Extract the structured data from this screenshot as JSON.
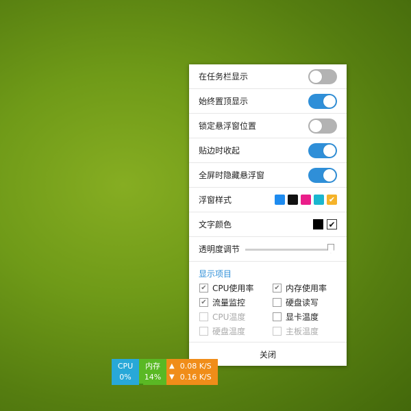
{
  "panel": {
    "toggles": [
      {
        "label": "在任务栏显示",
        "on": false
      },
      {
        "label": "始终置顶显示",
        "on": true
      },
      {
        "label": "锁定悬浮窗位置",
        "on": false
      },
      {
        "label": "贴边时收起",
        "on": true
      },
      {
        "label": "全屏时隐藏悬浮窗",
        "on": true
      }
    ],
    "style_label": "浮窗样式",
    "style_colors": [
      "#1e8bef",
      "#111111",
      "#ea1e8a",
      "#1bb6cf",
      "#f5b32a"
    ],
    "style_selected_index": 4,
    "text_color_label": "文字颜色",
    "text_colors": [
      "#000000",
      "#ffffff"
    ],
    "text_color_selected_index": 1,
    "opacity_label": "透明度调节",
    "opacity_level_percent": 100,
    "display_items_title": "显示项目",
    "display_items": [
      {
        "label": "CPU使用率",
        "checked": true,
        "enabled": true
      },
      {
        "label": "内存使用率",
        "checked": true,
        "enabled": true
      },
      {
        "label": "流量监控",
        "checked": true,
        "enabled": true
      },
      {
        "label": "硬盘读写",
        "checked": false,
        "enabled": true
      },
      {
        "label": "CPU温度",
        "checked": false,
        "enabled": false
      },
      {
        "label": "显卡温度",
        "checked": false,
        "enabled": true
      },
      {
        "label": "硬盘温度",
        "checked": false,
        "enabled": false
      },
      {
        "label": "主板温度",
        "checked": false,
        "enabled": false
      }
    ],
    "close_label": "关闭"
  },
  "monitor": {
    "cpu_label": "CPU",
    "cpu_value": "0%",
    "mem_label": "内存",
    "mem_value": "14%",
    "mem_percent": 14,
    "upload": "0.08 K/S",
    "download": "0.16 K/S",
    "colors": {
      "cpu": "#28a8d8",
      "mem": "#5ab824",
      "net": "#f08d19"
    }
  },
  "accent_color": "#2f8fd8"
}
